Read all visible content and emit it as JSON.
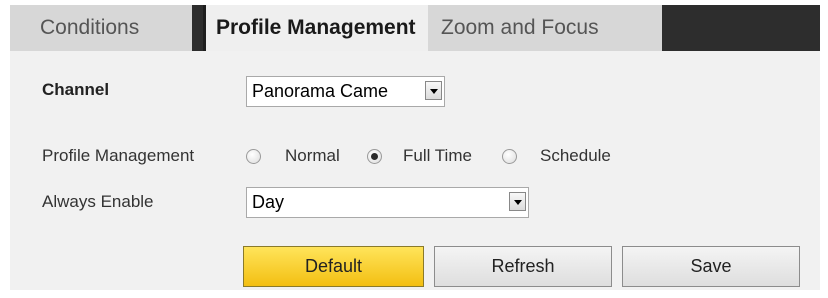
{
  "tabs": [
    {
      "label": "Conditions",
      "active": false
    },
    {
      "label": "Profile Management",
      "active": true
    },
    {
      "label": "Zoom and Focus",
      "active": false
    }
  ],
  "form": {
    "channel": {
      "label": "Channel",
      "value": "Panorama Came"
    },
    "profile_management": {
      "label": "Profile Management",
      "options": [
        "Normal",
        "Full Time",
        "Schedule"
      ],
      "selected": "Full Time"
    },
    "always_enable": {
      "label": "Always Enable",
      "value": "Day"
    }
  },
  "buttons": {
    "default": "Default",
    "refresh": "Refresh",
    "save": "Save"
  },
  "colors": {
    "tab_bar": "#2d2d2d",
    "panel": "#f1f1f1",
    "default_button": "#f7cf2a"
  }
}
